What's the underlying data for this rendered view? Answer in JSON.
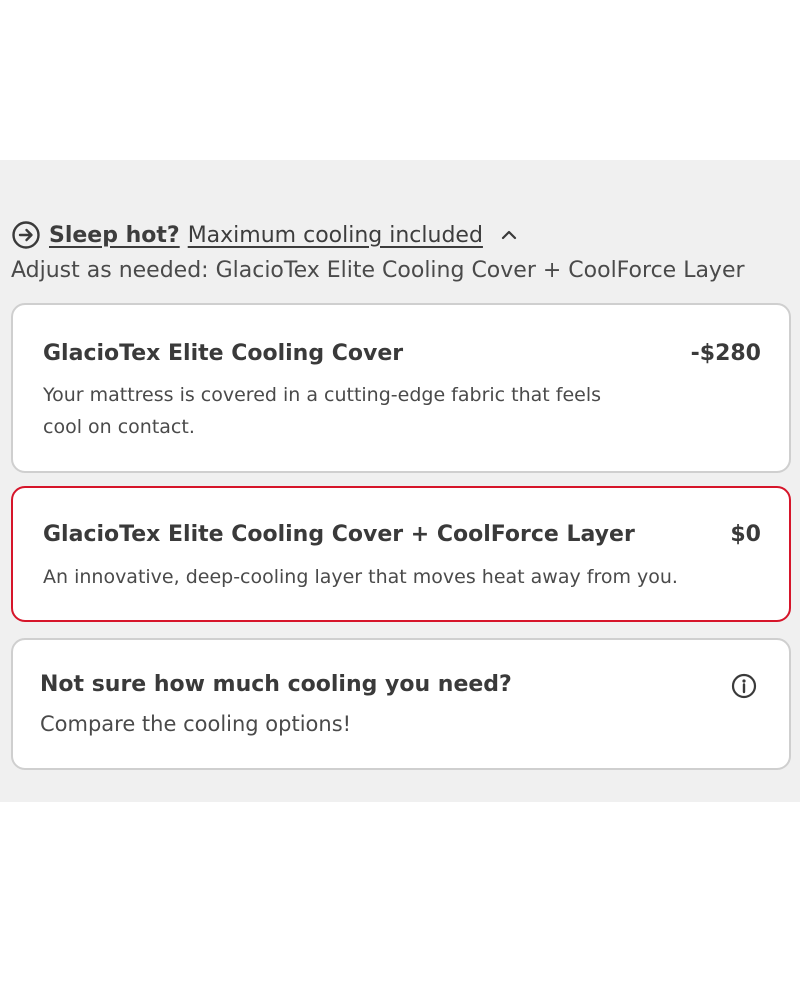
{
  "header": {
    "title": "Sleep hot?",
    "subtitle_link": "Maximum cooling included",
    "icon": "arrow-circle-right-icon",
    "toggle_icon": "chevron-up-icon"
  },
  "adjust_text": "Adjust as needed: GlacioTex Elite Cooling Cover + CoolForce Layer",
  "options": [
    {
      "title": "GlacioTex Elite Cooling Cover",
      "price": "-$280",
      "description": "Your mattress is covered in a cutting-edge fabric that feels cool on contact.",
      "selected": false
    },
    {
      "title": "GlacioTex Elite Cooling Cover + CoolForce Layer",
      "price": "$0",
      "description": "An innovative, deep-cooling layer that moves heat away from you.",
      "selected": true
    }
  ],
  "compare": {
    "title": "Not sure how much cooling you need?",
    "link": "Compare the cooling options!",
    "icon": "info-icon"
  },
  "colors": {
    "panel_bg": "#f0f0f0",
    "selected_border": "#d6152a",
    "card_border": "#cfcfcf"
  }
}
